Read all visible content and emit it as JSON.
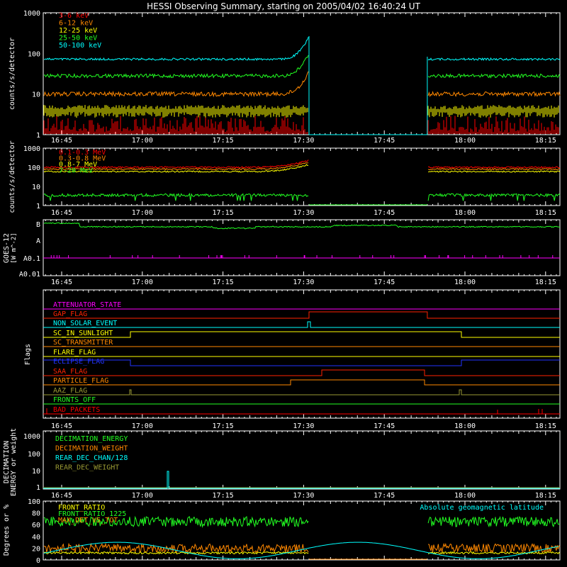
{
  "title": "HESSI Observing Summary, starting on 2005/04/02 16:40:24 UT",
  "chart_data": [
    {
      "type": "line",
      "name": "panel-lightcurves",
      "ylabel": "counts/s/detector",
      "ytick_labels": [
        "1",
        "10",
        "100",
        "1000"
      ],
      "ylim": [
        1,
        1000
      ],
      "log_y": true,
      "x_tick_labels": [
        "16:45",
        "17:00",
        "17:15",
        "17:30",
        "17:45",
        "18:00",
        "18:15"
      ],
      "gap": [
        "17:31",
        "17:53"
      ],
      "series": [
        {
          "name": "3-6 keV",
          "color": "#ff0000",
          "level": 2.0
        },
        {
          "name": "6-12 keV",
          "color": "#ff8800",
          "level": 10
        },
        {
          "name": "12-25 keV",
          "color": "#ffff00",
          "level": 3.5
        },
        {
          "name": "25-50 keV",
          "color": "#22ff22",
          "level": 30
        },
        {
          "name": "50-100 keV",
          "color": "#00ffff",
          "level": 70
        }
      ]
    },
    {
      "type": "line",
      "name": "panel-high-energy",
      "ylabel": "counts/s/detector",
      "ytick_labels": [
        "1",
        "10",
        "100",
        "1000"
      ],
      "ylim": [
        1,
        1000
      ],
      "log_y": true,
      "x_tick_labels": [
        "16:45",
        "17:00",
        "17:15",
        "17:30",
        "17:45",
        "18:00",
        "18:15"
      ],
      "series": [
        {
          "name": "0.1-0.3 MeV",
          "color": "#ff0000",
          "level": 100
        },
        {
          "name": "0.3-0.8 MeV",
          "color": "#ff8800",
          "level": 80
        },
        {
          "name": "0.8-7 MeV",
          "color": "#ffff00",
          "level": 60
        },
        {
          "name": "7-20 MeV",
          "color": "#22ff22",
          "level": 3.5
        }
      ]
    },
    {
      "type": "line",
      "name": "panel-goes",
      "ylabel": "GOES-12",
      "ylabel2": "[W m^-2]",
      "ytick_labels": [
        "B",
        "A",
        "A0.1",
        "A0.01"
      ],
      "x_tick_labels": [
        "16:45",
        "17:00",
        "17:15",
        "17:30",
        "17:45",
        "18:00",
        "18:15"
      ]
    },
    {
      "type": "line",
      "name": "panel-flags",
      "ylabel": "Flags",
      "x_tick_labels": [
        "16:45",
        "17:00",
        "17:15",
        "17:30",
        "17:45",
        "18:00",
        "18:15"
      ],
      "flags": [
        {
          "name": "ATTENUATOR_STATE",
          "color": "#ff00ff"
        },
        {
          "name": "GAP_FLAG",
          "color": "#ff2200"
        },
        {
          "name": "NON_SOLAR_EVENT",
          "color": "#00ffff"
        },
        {
          "name": "SC_IN_SUNLIGHT",
          "color": "#ffff00"
        },
        {
          "name": "SC_TRANSMITTER",
          "color": "#ff8800"
        },
        {
          "name": "FLARE_FLAG",
          "color": "#ffff00"
        },
        {
          "name": "ECLIPSE_FLAG",
          "color": "#2233ff"
        },
        {
          "name": "SAA_FLAG",
          "color": "#ff2200"
        },
        {
          "name": "PARTICLE_FLAG",
          "color": "#ff8800"
        },
        {
          "name": "AAZ_FLAG",
          "color": "#999933"
        },
        {
          "name": "FRONTS_OFF",
          "color": "#22ff22"
        },
        {
          "name": "BAD_PACKETS",
          "color": "#ff0000"
        }
      ]
    },
    {
      "type": "line",
      "name": "panel-decimation",
      "ylabel": "DECIMATION",
      "ylabel2": "ENERGY or weight",
      "ytick_labels": [
        "1",
        "10",
        "100",
        "1000"
      ],
      "log_y": true,
      "x_tick_labels": [
        "16:45",
        "17:00",
        "17:15",
        "17:30",
        "17:45",
        "18:00",
        "18:15"
      ],
      "series": [
        {
          "name": "DECIMATION_ENERGY",
          "color": "#22ff22"
        },
        {
          "name": "DECIMATION_WEIGHT",
          "color": "#ff8800"
        },
        {
          "name": "REAR_DEC_CHAN/128",
          "color": "#00ffff"
        },
        {
          "name": "REAR_DEC_WEIGHT",
          "color": "#999933"
        }
      ]
    },
    {
      "type": "line",
      "name": "panel-ratios",
      "ylabel": "Degrees or %",
      "ytick_labels": [
        "0",
        "20",
        "40",
        "60",
        "80",
        "100"
      ],
      "ylim": [
        0,
        100
      ],
      "series": [
        {
          "name": "FRONT_RATIO",
          "color": "#ffff00"
        },
        {
          "name": "FRONT_RATIO_1225",
          "color": "#22ff22"
        },
        {
          "name": "MAX_DET_VS_TOT",
          "color": "#ff8800"
        },
        {
          "name": "Absolute geomagnetic latitude",
          "color": "#00ffff"
        }
      ]
    }
  ]
}
